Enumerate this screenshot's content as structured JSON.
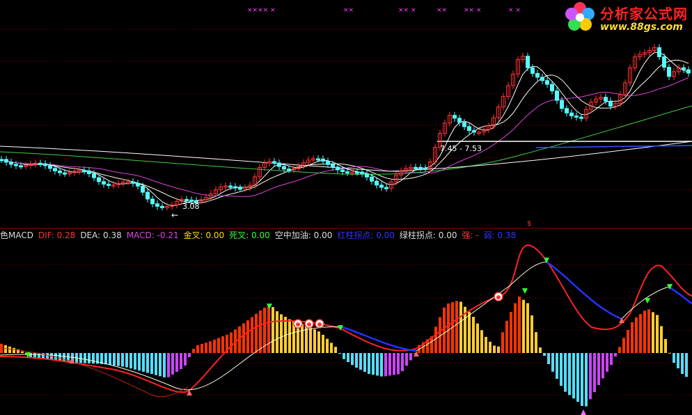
{
  "logo": {
    "title": "分析家公式网",
    "url": "www.88gs.com"
  },
  "top_markers": [
    {
      "text": "××××  ×"
    },
    {
      "text": "××"
    },
    {
      "text": "××  ×"
    },
    {
      "text": "××"
    },
    {
      "text": "××  ×"
    },
    {
      "text": "×  ×"
    }
  ],
  "price_labels": {
    "low": "3.08",
    "range": "7.45 - 7.53",
    "arrow": "←",
    "s_marker": "$"
  },
  "indicator_legend": [
    {
      "text": "色MACD",
      "color": "#dddddd"
    },
    {
      "text": "DIF: 0.28",
      "color": "#ff3333"
    },
    {
      "text": "DEA: 0.38",
      "color": "#dddddd"
    },
    {
      "text": "MACD: -0.21",
      "color": "#dd44dd"
    },
    {
      "text": "金叉: 0.00",
      "color": "#ffdd00"
    },
    {
      "text": "死叉: 0.00",
      "color": "#33ff33"
    },
    {
      "text": "空中加油: 0.00",
      "color": "#dddddd"
    },
    {
      "text": "红柱拐点: 0.00",
      "color": "#3333ff"
    },
    {
      "text": "绿柱拐点: 0.00",
      "color": "#dddddd"
    },
    {
      "text": "强: -",
      "color": "#ff3333"
    },
    {
      "text": "弱: 0.38",
      "color": "#3333ff"
    }
  ],
  "colors": {
    "background": "#000000",
    "grid": "#8b0000",
    "candle_up": "#ff3333",
    "candle_down": "#55ffff",
    "ma5": "#ffffff",
    "ma10": "#ffffee",
    "ma20": "#dd44dd",
    "ma60": "#44cc44",
    "ma120": "#ffffff",
    "hist_red": "#ff3300",
    "hist_yellow": "#ffcc33",
    "hist_cyan": "#55ddff",
    "hist_magenta": "#cc44ff",
    "dif": "#ff2222",
    "dea_down": "#2233ff",
    "dea_up": "#ffffdd"
  }
}
